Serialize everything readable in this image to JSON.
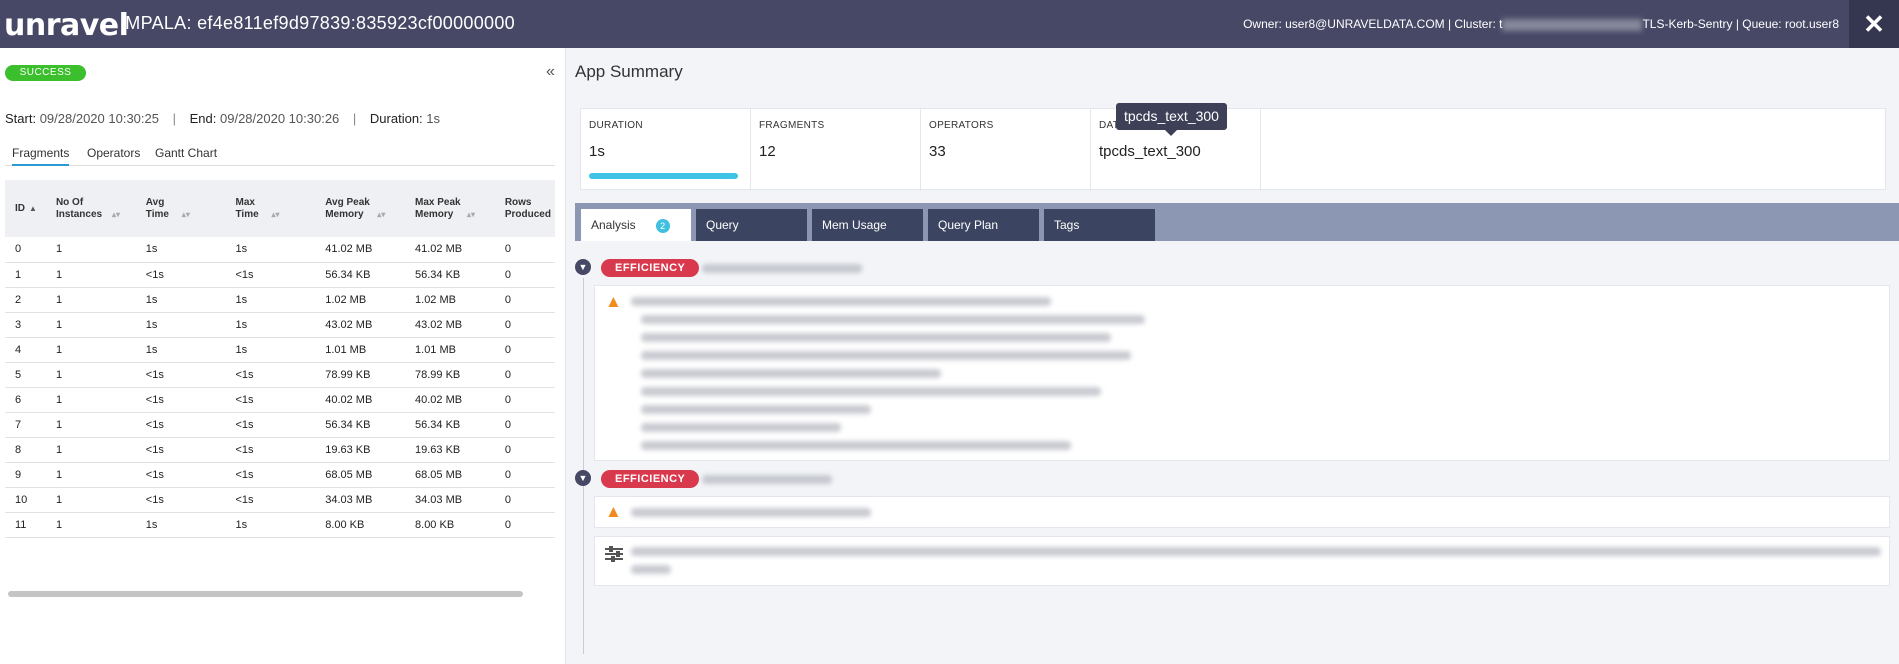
{
  "header": {
    "logo": "unravel",
    "app_title": "IMPALA:  ef4e811ef9d97839:835923cf00000000",
    "owner": "Owner: user8@UNRAVELDATA.COM | Cluster: t",
    "cluster_suffix": "TLS-Kerb-Sentry | Queue: root.user8",
    "close_label": "✕"
  },
  "left": {
    "status": "SUCCESS",
    "collapse_label": "«",
    "start_label": "Start:",
    "start_value": "09/28/2020 10:30:25",
    "end_label": "End:",
    "end_value": "09/28/2020 10:30:26",
    "duration_label": "Duration:",
    "duration_value": "1s",
    "tabs": [
      "Fragments",
      "Operators",
      "Gantt Chart"
    ],
    "columns": [
      "ID",
      "No Of Instances",
      "Avg Time",
      "Max Time",
      "Avg Peak Memory",
      "Max Peak Memory",
      "Rows Produced"
    ],
    "rows": [
      [
        "0",
        "1",
        "1s",
        "1s",
        "41.02 MB",
        "41.02 MB",
        "0"
      ],
      [
        "1",
        "1",
        "<1s",
        "<1s",
        "56.34 KB",
        "56.34 KB",
        "0"
      ],
      [
        "2",
        "1",
        "1s",
        "1s",
        "1.02 MB",
        "1.02 MB",
        "0"
      ],
      [
        "3",
        "1",
        "1s",
        "1s",
        "43.02 MB",
        "43.02 MB",
        "0"
      ],
      [
        "4",
        "1",
        "1s",
        "1s",
        "1.01 MB",
        "1.01 MB",
        "0"
      ],
      [
        "5",
        "1",
        "<1s",
        "<1s",
        "78.99 KB",
        "78.99 KB",
        "0"
      ],
      [
        "6",
        "1",
        "<1s",
        "<1s",
        "40.02 MB",
        "40.02 MB",
        "0"
      ],
      [
        "7",
        "1",
        "<1s",
        "<1s",
        "56.34 KB",
        "56.34 KB",
        "0"
      ],
      [
        "8",
        "1",
        "<1s",
        "<1s",
        "19.63 KB",
        "19.63 KB",
        "0"
      ],
      [
        "9",
        "1",
        "<1s",
        "<1s",
        "68.05 MB",
        "68.05 MB",
        "0"
      ],
      [
        "10",
        "1",
        "<1s",
        "<1s",
        "34.03 MB",
        "34.03 MB",
        "0"
      ],
      [
        "11",
        "1",
        "1s",
        "1s",
        "8.00 KB",
        "8.00 KB",
        "0"
      ]
    ]
  },
  "right": {
    "title": "App Summary",
    "cards": [
      {
        "label": "DURATION",
        "value": "1s"
      },
      {
        "label": "FRAGMENTS",
        "value": "12"
      },
      {
        "label": "OPERATORS",
        "value": "33"
      },
      {
        "label": "DAT",
        "value": "tpcds_text_300"
      }
    ],
    "tooltip": "tpcds_text_300",
    "tabs": [
      "Analysis",
      "Query",
      "Mem Usage",
      "Query Plan",
      "Tags"
    ],
    "analysis_badge": "2",
    "efficiency_label": "EFFICIENCY",
    "colors": {
      "header": "#464866",
      "success": "#3bbf2c",
      "efficiency": "#d9394d",
      "accent": "#40c4e6"
    },
    "icons": [
      "warning-icon",
      "warning-icon",
      "settings-icon",
      "chevron-down-icon"
    ]
  }
}
